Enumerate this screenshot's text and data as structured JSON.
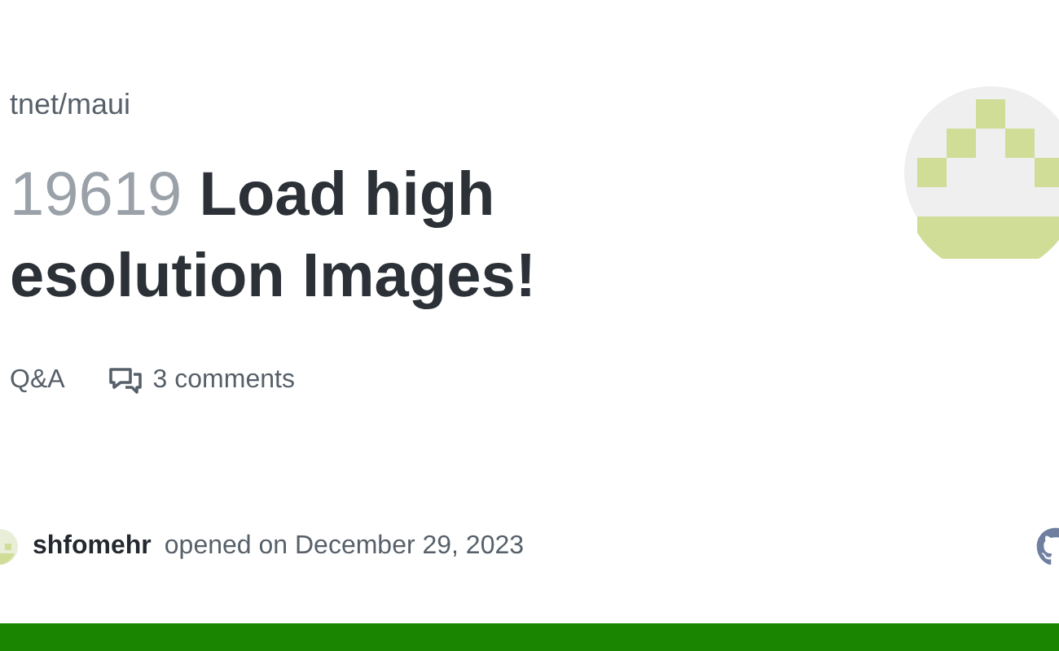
{
  "repo": "tnet/maui",
  "issue": {
    "number": "19619",
    "title": "Load high esolution Images!"
  },
  "meta": {
    "category": "Q&A",
    "comments": "3 comments"
  },
  "author": {
    "name": "shfomehr",
    "opened": "opened on December 29, 2023"
  }
}
